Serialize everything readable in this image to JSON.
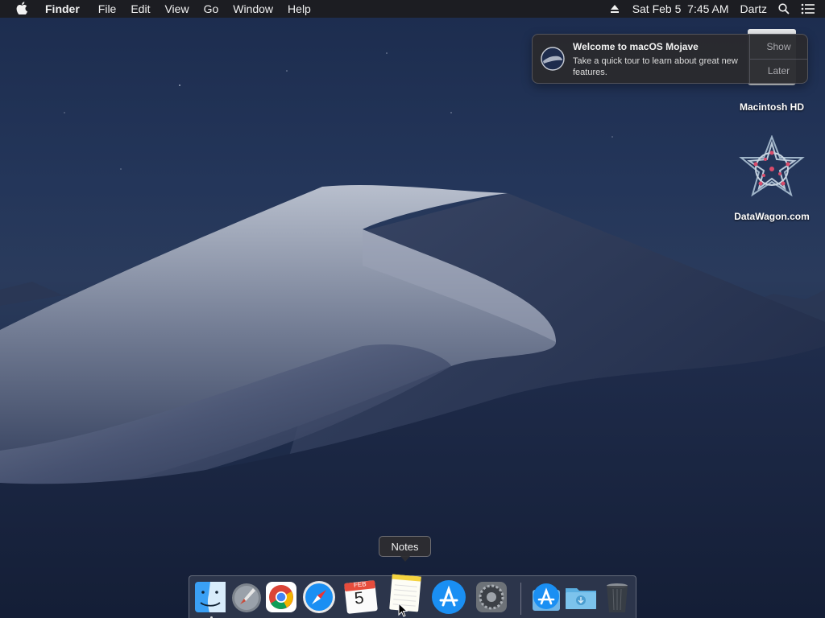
{
  "menubar": {
    "app_name": "Finder",
    "menus": [
      "File",
      "Edit",
      "View",
      "Go",
      "Window",
      "Help"
    ],
    "datetime": "Sat Feb 5  7:45 AM",
    "user": "Dartz",
    "icons": [
      "apple-logo-icon",
      "eject-icon",
      "search-icon",
      "notification-center-icon"
    ]
  },
  "notification": {
    "title": "Welcome to macOS Mojave",
    "body": "Take a quick tour to learn about great new features.",
    "actions": [
      "Show",
      "Later"
    ]
  },
  "desktop": {
    "icons": [
      {
        "label": "Macintosh HD",
        "icon": "hard-drive-icon"
      },
      {
        "label": "DataWagon.com",
        "icon": "datawagon-icon"
      }
    ]
  },
  "tooltip": {
    "text": "Notes"
  },
  "dock": {
    "items": [
      {
        "name": "Finder",
        "icon": "finder-icon",
        "running": true
      },
      {
        "name": "Launchpad",
        "icon": "launchpad-icon",
        "running": false
      },
      {
        "name": "Google Chrome",
        "icon": "chrome-icon",
        "running": false
      },
      {
        "name": "Safari",
        "icon": "safari-icon",
        "running": false
      },
      {
        "name": "Calendar",
        "icon": "calendar-icon",
        "running": false,
        "month": "FEB",
        "day": "5"
      },
      {
        "name": "Notes",
        "icon": "notes-icon",
        "running": false
      },
      {
        "name": "App Store",
        "icon": "app-store-icon",
        "running": false
      },
      {
        "name": "System Preferences",
        "icon": "system-preferences-icon",
        "running": false
      },
      {
        "name": "Applications",
        "icon": "applications-stack-icon",
        "running": false
      },
      {
        "name": "Downloads",
        "icon": "downloads-folder-icon",
        "running": false
      },
      {
        "name": "Trash",
        "icon": "trash-icon",
        "running": false
      }
    ]
  },
  "colors": {
    "menubar_bg": "#1c1c1e",
    "desktop_sky": "#1c2c4e",
    "accent_blue": "#1a8ff3"
  }
}
